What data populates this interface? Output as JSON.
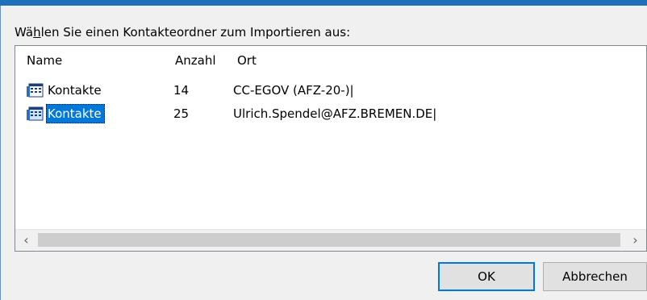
{
  "dialog": {
    "prompt_before": "Wä",
    "prompt_accesskey": "h",
    "prompt_after": "len Sie einen Kontakteordner zum Importieren aus:"
  },
  "list": {
    "columns": {
      "name": "Name",
      "anzahl": "Anzahl",
      "ort": "Ort"
    },
    "rows": [
      {
        "name": "Kontakte",
        "count": "14",
        "place": "CC-EGOV (AFZ-20-)|",
        "selected": false,
        "icon": "contacts-folder-icon"
      },
      {
        "name": "Kontakte",
        "count": "25",
        "place": "Ulrich.Spendel@AFZ.BREMEN.DE|",
        "selected": true,
        "icon": "contacts-folder-icon"
      }
    ],
    "scroll_left": "‹",
    "scroll_right": "›"
  },
  "buttons": {
    "ok": "OK",
    "cancel": "Abbrechen"
  },
  "colors": {
    "title_bar": "#1f6fb9",
    "selection": "#0078d7",
    "default_button_border": "#0078d7"
  }
}
